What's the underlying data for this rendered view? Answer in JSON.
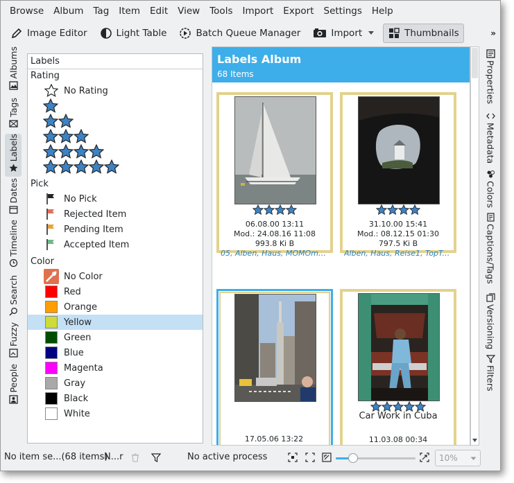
{
  "menubar": {
    "items": [
      "Browse",
      "Album",
      "Tag",
      "Item",
      "Edit",
      "View",
      "Tools",
      "Import",
      "Export",
      "Settings",
      "Help"
    ]
  },
  "toolbar": {
    "image_editor": "Image Editor",
    "light_table": "Light Table",
    "batch_queue": "Batch Queue Manager",
    "import": "Import",
    "thumbnails": "Thumbnails",
    "more": "»"
  },
  "left_tabs": [
    "Albums",
    "Tags",
    "Labels",
    "Dates",
    "Timeline",
    "Search",
    "Fuzzy",
    "People"
  ],
  "right_tabs": [
    "Properties",
    "Metadata",
    "Colors",
    "Captions/Tags",
    "Versioning",
    "Filters"
  ],
  "labels_panel": {
    "header": "Labels",
    "rating_group": "Rating",
    "no_rating": "No Rating",
    "pick_group": "Pick",
    "pick_items": [
      "No Pick",
      "Rejected Item",
      "Pending Item",
      "Accepted Item"
    ],
    "color_group": "Color",
    "no_color": "No Color",
    "colors": [
      {
        "label": "Red",
        "hex": "#ff0000"
      },
      {
        "label": "Orange",
        "hex": "#ff9e00"
      },
      {
        "label": "Yellow",
        "hex": "#cddc39"
      },
      {
        "label": "Green",
        "hex": "#004d00"
      },
      {
        "label": "Blue",
        "hex": "#000080"
      },
      {
        "label": "Magenta",
        "hex": "#ff00ff"
      },
      {
        "label": "Gray",
        "hex": "#a9a9a9"
      },
      {
        "label": "Black",
        "hex": "#000000"
      },
      {
        "label": "White",
        "hex": "#ffffff"
      }
    ],
    "selected": "Yellow"
  },
  "album": {
    "title": "Labels Album",
    "count": "68 Items",
    "items": [
      {
        "date": "06.08.00 13:11",
        "mod": "Mod.: 24.08.16 11:08",
        "size": "993.8 Ki B",
        "tags": "05, Alben, Haus, MOMOme...",
        "rating": 4
      },
      {
        "date": "31.10.00 15:41",
        "mod": "Mod.: 08.12.15 01:30",
        "size": "797.5 Ki B",
        "tags": "Alben, Haus, Reise1, TopTen...",
        "rating": 4
      },
      {
        "date": "17.05.06 13:22",
        "rating": 0
      },
      {
        "title": "Car Work in Cuba",
        "date": "11.03.08 00:34",
        "rating": 5
      }
    ]
  },
  "statusbar": {
    "selection": "No item se...(68 items)",
    "filter": "N...r",
    "process": "No active process",
    "zoom": "10%"
  },
  "colors": {
    "accent": "#3daee9",
    "star_fill": "#3d83c4",
    "thumb_border": "#e2d28c",
    "selection": "#c4e0f5"
  }
}
